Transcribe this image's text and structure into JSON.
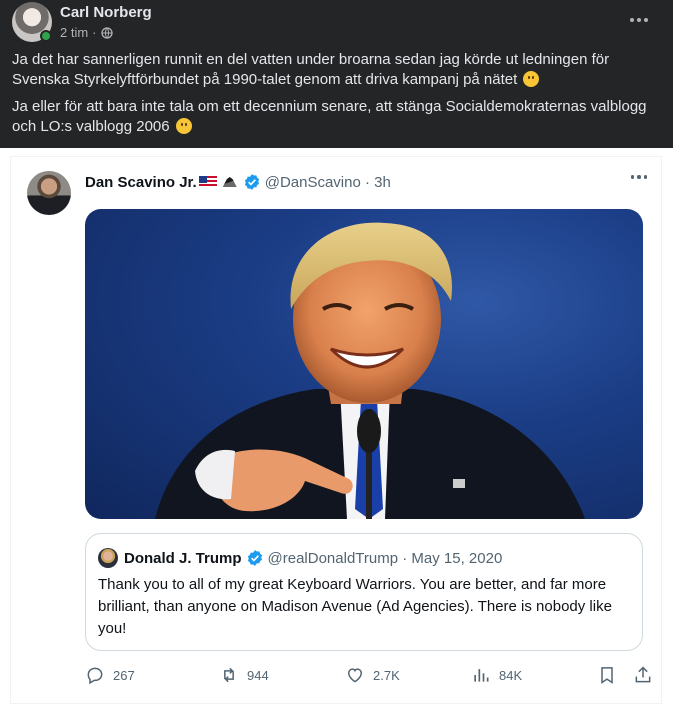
{
  "post": {
    "author": "Carl Norberg",
    "time": "2 tim",
    "paragraphs": [
      "Ja det har sannerligen runnit en del vatten under broarna sedan jag körde ut ledningen för Svenska Styrkelyftförbundet på 1990-talet genom att driva kampanj på nätet",
      "Ja eller för att bara inte tala om ett decennium senare, att stänga Socialdemokraternas valblogg och LO:s  valblogg 2006"
    ]
  },
  "tweet": {
    "name": "Dan Scavino Jr.",
    "handle_time": "@DanScavino · 3h",
    "quote": {
      "name": "Donald J. Trump",
      "handle_date": "@realDonaldTrump · May 15, 2020",
      "text": "Thank you to all of my great Keyboard Warriors. You are better, and far more brilliant, than anyone on Madison Avenue (Ad Agencies). There is nobody like you!"
    },
    "stats": {
      "replies": "267",
      "retweets": "944",
      "likes": "2.7K",
      "views": "84K"
    }
  },
  "colors": {
    "facebook_bg": "#242526",
    "verified_blue": "#1d9bf0",
    "online_green": "#31a24c",
    "tweet_text": "#0f1419",
    "tweet_muted": "#536471"
  },
  "icons": {
    "post_meta": "globe-icon",
    "post_menu": "more-horizontal-icon",
    "verified": "verified-badge-icon",
    "reply": "reply-icon",
    "retweet": "retweet-icon",
    "like": "heart-icon",
    "views": "analytics-icon",
    "bookmark": "bookmark-icon",
    "share": "share-icon"
  }
}
